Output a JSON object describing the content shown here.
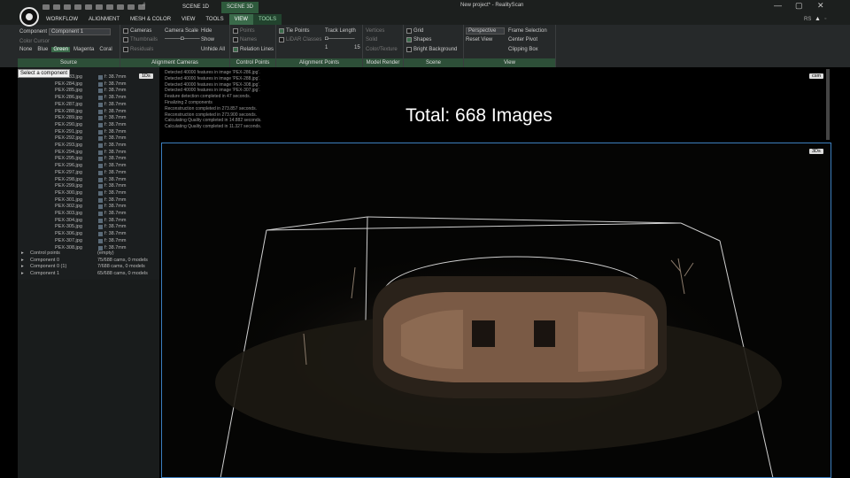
{
  "titlebar": {
    "scene_tabs": [
      "SCENE 1D",
      "SCENE 3D"
    ],
    "window_title": "New project* - RealityScan",
    "min": "—",
    "max": "▢",
    "close": "✕",
    "hash": "#"
  },
  "menu": {
    "items": [
      "WORKFLOW",
      "ALIGNMENT",
      "MESH & COLOR",
      "VIEW",
      "TOOLS"
    ],
    "active": "VIEW",
    "context": "TOOLS",
    "right_tag": "RS"
  },
  "ribbon": {
    "source": {
      "component_label": "Component",
      "component_value": "Component 1",
      "color_cursor": "Color Cursor",
      "colors": [
        "None",
        "Blue",
        "Green",
        "Magenta",
        "Coral"
      ],
      "selected_color": "Green",
      "label": "Source"
    },
    "alignment_cameras": {
      "cameras": "Cameras",
      "thumbnails": "Thumbnails",
      "residuals": "Residuals",
      "camera_scale": "Camera Scale",
      "hide": "Hide",
      "show": "Show",
      "unhide_all": "Unhide All",
      "label": "Alignment Cameras"
    },
    "control_points": {
      "points": "Points",
      "names": "Names",
      "relation_lines": "Relation Lines",
      "label": "Control Points"
    },
    "alignment_points": {
      "tie_points": "Tie Points",
      "lidar_classes": "LiDAR Classes",
      "track_length": "Track Length",
      "min": "1",
      "max": "15",
      "label": "Alignment Points"
    },
    "model_render": {
      "vertices": "Vertices",
      "solid": "Solid",
      "color_texture": "Color/Texture",
      "label": "Model Render"
    },
    "scene": {
      "grid": "Grid",
      "shapes": "Shapes",
      "bright_background": "Bright Background",
      "label": "Scene"
    },
    "view": {
      "projection": "Perspective",
      "reset_view": "Reset View",
      "frame_selection": "Frame Selection",
      "center_pivot": "Center Pivot",
      "clipping_box": "Clipping Box",
      "label": "View"
    }
  },
  "tooltip": "Select a component",
  "tree": {
    "rows": [
      {
        "name": "PEX-283.jpg",
        "focal": "f: 38.7mm"
      },
      {
        "name": "PEX-284.jpg",
        "focal": "f: 38.7mm"
      },
      {
        "name": "PEX-285.jpg",
        "focal": "f: 38.7mm"
      },
      {
        "name": "PEX-286.jpg",
        "focal": "f: 38.7mm"
      },
      {
        "name": "PEX-287.jpg",
        "focal": "f: 38.7mm"
      },
      {
        "name": "PEX-288.jpg",
        "focal": "f: 38.7mm"
      },
      {
        "name": "PEX-289.jpg",
        "focal": "f: 38.7mm"
      },
      {
        "name": "PEX-290.jpg",
        "focal": "f: 38.7mm"
      },
      {
        "name": "PEX-291.jpg",
        "focal": "f: 38.7mm"
      },
      {
        "name": "PEX-292.jpg",
        "focal": "f: 38.7mm"
      },
      {
        "name": "PEX-293.jpg",
        "focal": "f: 38.7mm"
      },
      {
        "name": "PEX-294.jpg",
        "focal": "f: 38.7mm"
      },
      {
        "name": "PEX-295.jpg",
        "focal": "f: 38.7mm"
      },
      {
        "name": "PEX-296.jpg",
        "focal": "f: 38.7mm"
      },
      {
        "name": "PEX-297.jpg",
        "focal": "f: 38.7mm"
      },
      {
        "name": "PEX-298.jpg",
        "focal": "f: 38.7mm"
      },
      {
        "name": "PEX-299.jpg",
        "focal": "f: 38.7mm"
      },
      {
        "name": "PEX-300.jpg",
        "focal": "f: 38.7mm"
      },
      {
        "name": "PEX-301.jpg",
        "focal": "f: 38.7mm"
      },
      {
        "name": "PEX-302.jpg",
        "focal": "f: 38.7mm"
      },
      {
        "name": "PEX-303.jpg",
        "focal": "f: 38.7mm"
      },
      {
        "name": "PEX-304.jpg",
        "focal": "f: 38.7mm"
      },
      {
        "name": "PEX-305.jpg",
        "focal": "f: 38.7mm"
      },
      {
        "name": "PEX-306.jpg",
        "focal": "f: 38.7mm"
      },
      {
        "name": "PEX-307.jpg",
        "focal": "f: 38.7mm"
      },
      {
        "name": "PEX-308.jpg",
        "focal": "f: 38.7mm"
      }
    ],
    "comp_rows": [
      {
        "name": "Control points",
        "info": "(empty)"
      },
      {
        "name": "Component 0",
        "info": "75/688 cams, 0 models"
      },
      {
        "name": "Component 0 (1)",
        "info": "7/688 cams, 0 models"
      },
      {
        "name": "Component 1",
        "info": "65/688 cams, 0 models"
      }
    ]
  },
  "log": {
    "lines": [
      "Detected 40000 features in image 'PEX-286.jpg'.",
      "Detected 40000 features in image 'PEX-288.jpg'.",
      "Detected 40000 features in image 'PEX-308.jpg'.",
      "Detected 40000 features in image 'PEX-307.jpg'.",
      "Feature detection completed in 47 seconds.",
      "Finalizing 2 components",
      "Reconstruction completed in 273.857 seconds.",
      "Reconstruction completed in 273.900 seconds.",
      "Calculating Quality completed in 14.882 seconds.",
      "Calculating Quality completed in 11.327 seconds."
    ],
    "badge": "1Ds",
    "right_badge": "csm"
  },
  "overlay_total": "Total: 668 Images",
  "view3d": {
    "badge": "3Ds"
  }
}
